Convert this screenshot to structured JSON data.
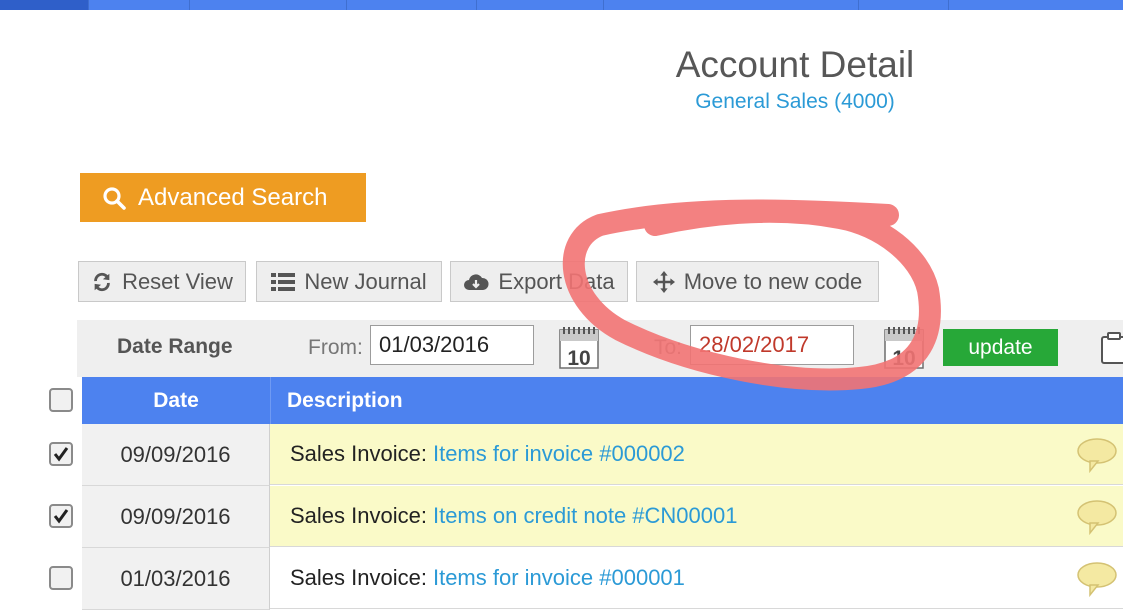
{
  "colors": {
    "nav": "#4d82ef",
    "accent_orange": "#ee9c22",
    "update_green": "#27a838",
    "link_blue": "#2b9ad6",
    "highlight_row": "#fafac8",
    "annotation_red": "#f27373"
  },
  "header": {
    "title": "Account Detail",
    "subtitle": "General Sales (4000)"
  },
  "advanced_search": {
    "label": "Advanced Search",
    "icon": "search-icon"
  },
  "toolbar": {
    "reset_label": "Reset View",
    "journal_label": "New Journal",
    "export_label": "Export Data",
    "move_label": "Move to new code"
  },
  "date_range": {
    "label": "Date Range",
    "from_label": "From:",
    "from_value": "01/03/2016",
    "to_label": "To:",
    "to_value": "28/02/2017",
    "calendar_day": "10",
    "update_label": "update"
  },
  "table": {
    "col_date": "Date",
    "col_desc": "Description",
    "rows": [
      {
        "checked": true,
        "date": "09/09/2016",
        "type": "Sales Invoice:",
        "link": "Items for invoice #000002",
        "highlight": true
      },
      {
        "checked": true,
        "date": "09/09/2016",
        "type": "Sales Invoice:",
        "link": "Items on credit note #CN00001",
        "highlight": true
      },
      {
        "checked": false,
        "date": "01/03/2016",
        "type": "Sales Invoice:",
        "link": "Items for invoice #000001",
        "highlight": false
      }
    ]
  }
}
